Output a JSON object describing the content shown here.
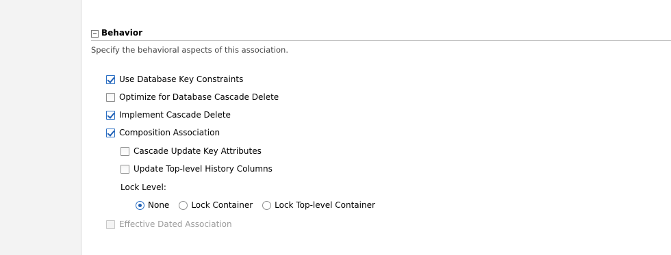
{
  "section": {
    "title": "Behavior",
    "description": "Specify the behavioral aspects of this association."
  },
  "options": {
    "use_db_key_constraints": {
      "label": "Use Database Key Constraints",
      "checked": true
    },
    "optimize_db_cascade_delete": {
      "label": "Optimize for Database Cascade Delete",
      "checked": false
    },
    "implement_cascade_delete": {
      "label": "Implement Cascade Delete",
      "checked": true
    },
    "composition_association": {
      "label": "Composition Association",
      "checked": true
    },
    "cascade_update_key_attrs": {
      "label": "Cascade Update Key Attributes",
      "checked": false
    },
    "update_top_level_history": {
      "label": "Update Top-level History Columns",
      "checked": false
    },
    "effective_dated_association": {
      "label": "Effective Dated Association",
      "checked": false,
      "disabled": true
    }
  },
  "lock_level": {
    "label": "Lock Level:",
    "choices": [
      "None",
      "Lock Container",
      "Lock Top-level Container"
    ],
    "selected": "None"
  }
}
